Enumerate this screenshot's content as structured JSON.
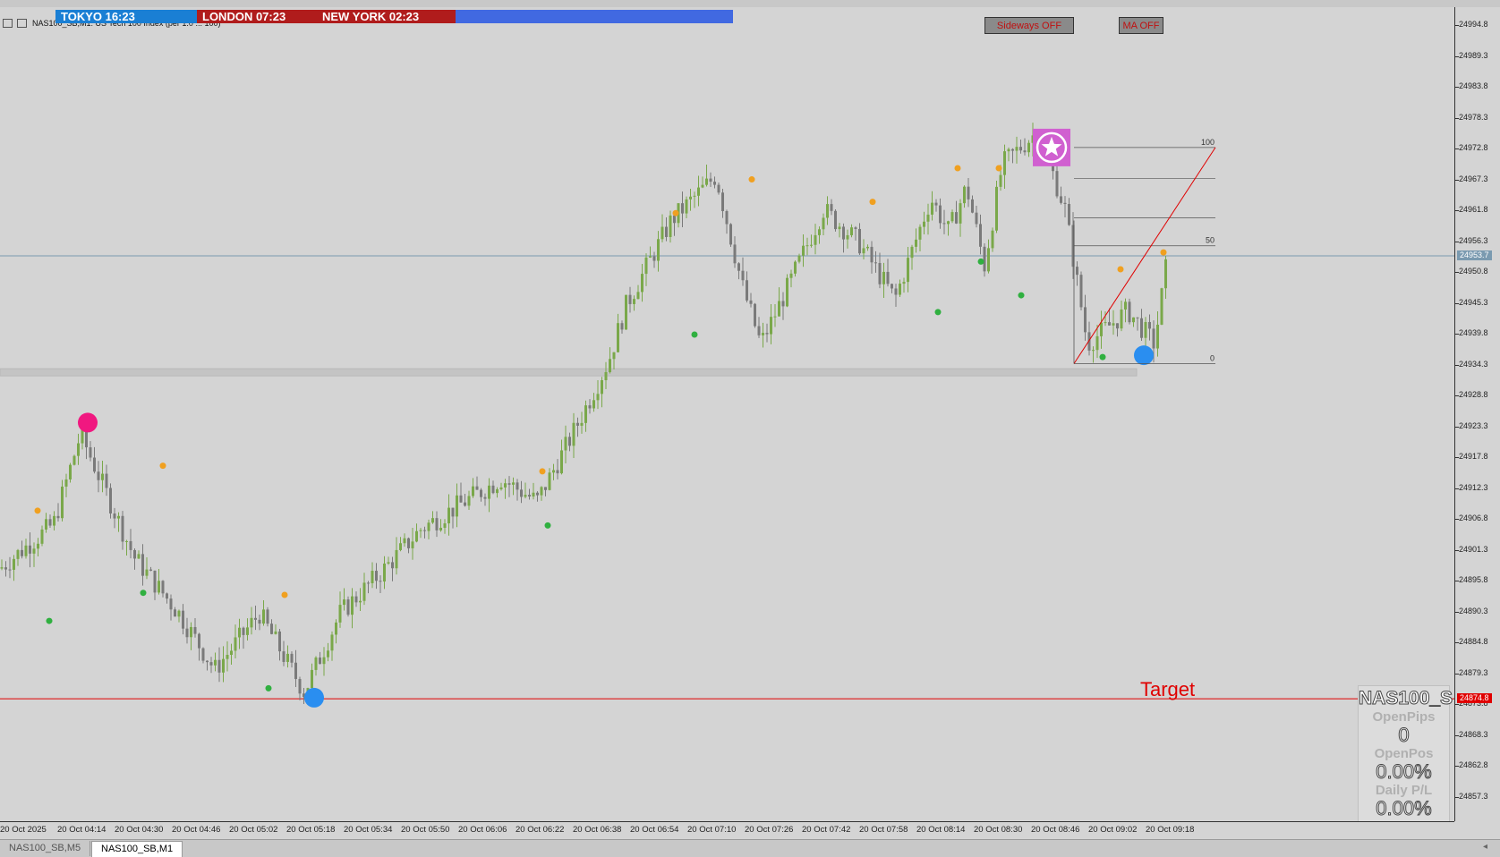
{
  "window": {
    "title": "NAS100_SB,M1",
    "chart_title": "NAS100_SB,M1: US Tech 100 Index (per 1.0 ... 100)"
  },
  "sessions": [
    {
      "label": "TOKYO  16:23",
      "color": "#1a7fd4"
    },
    {
      "label": "LONDON  07:23",
      "color": "#b01c1c"
    },
    {
      "label": "NEW YORK  02:23",
      "color": "#b01c1c"
    }
  ],
  "session_bar_color": "#4169e1",
  "buttons": {
    "sideways": "Sideways OFF",
    "ma": "MA OFF"
  },
  "stats_panel": {
    "symbol": "NAS100_S",
    "open_pips_label": "OpenPips",
    "open_pips_value": "0",
    "open_pos_label": "OpenPos",
    "open_pos_value": "0.00%",
    "daily_pl_label": "Daily P/L",
    "daily_pl_value": "0.00%"
  },
  "target_label": "Target",
  "tabs": [
    {
      "label": "NAS100_SB,M5",
      "active": false
    },
    {
      "label": "NAS100_SB,M1",
      "active": true
    }
  ],
  "price_axis": {
    "ticks": [
      "24994.8",
      "24989.3",
      "24983.8",
      "24978.3",
      "24972.8",
      "24967.3",
      "24961.8",
      "24956.3",
      "24950.8",
      "24945.3",
      "24939.8",
      "24934.3",
      "24928.8",
      "24923.3",
      "24917.8",
      "24912.3",
      "24906.8",
      "24901.3",
      "24895.8",
      "24890.3",
      "24884.8",
      "24879.3",
      "24873.8",
      "24868.3",
      "24862.8",
      "24857.3"
    ],
    "current_price": "24953.7",
    "target_price": "24874.8"
  },
  "time_axis": {
    "labels": [
      "20 Oct 2025",
      "20 Oct 04:14",
      "20 Oct 04:30",
      "20 Oct 04:46",
      "20 Oct 05:02",
      "20 Oct 05:18",
      "20 Oct 05:34",
      "20 Oct 05:50",
      "20 Oct 06:06",
      "20 Oct 06:22",
      "20 Oct 06:38",
      "20 Oct 06:54",
      "20 Oct 07:10",
      "20 Oct 07:26",
      "20 Oct 07:42",
      "20 Oct 07:58",
      "20 Oct 08:14",
      "20 Oct 08:30",
      "20 Oct 08:46",
      "20 Oct 09:02",
      "20 Oct 09:18"
    ]
  },
  "fib_levels": [
    "100",
    "50",
    "0"
  ],
  "colors": {
    "background": "#d4d4d4",
    "bull_candle": "#7aa84a",
    "bear_candle": "#7a7a7a",
    "swing_high_dot": "#f0a020",
    "swing_low_dot": "#30b040",
    "target_line": "#e00000",
    "current_price_line": "#7a9ab0",
    "big_dot_blue": "#2a8ef0",
    "big_dot_pink": "#f01880",
    "star_bg": "#d060d0"
  },
  "chart_data": {
    "type": "candlestick",
    "symbol": "NAS100_SB",
    "timeframe": "M1",
    "path": [
      [
        0,
        24898
      ],
      [
        30,
        24902
      ],
      [
        60,
        24906
      ],
      [
        90,
        24922
      ],
      [
        150,
        24900
      ],
      [
        200,
        24890
      ],
      [
        240,
        24880
      ],
      [
        290,
        24890
      ],
      [
        340,
        24876
      ],
      [
        380,
        24890
      ],
      [
        430,
        24898
      ],
      [
        470,
        24905
      ],
      [
        520,
        24910
      ],
      [
        560,
        24914
      ],
      [
        600,
        24910
      ],
      [
        640,
        24922
      ],
      [
        680,
        24935
      ],
      [
        700,
        24945
      ],
      [
        750,
        24960
      ],
      [
        800,
        24968
      ],
      [
        830,
        24948
      ],
      [
        850,
        24938
      ],
      [
        880,
        24948
      ],
      [
        920,
        24962
      ],
      [
        960,
        24956
      ],
      [
        1000,
        24946
      ],
      [
        1040,
        24964
      ],
      [
        1060,
        24958
      ],
      [
        1080,
        24966
      ],
      [
        1100,
        24952
      ],
      [
        1120,
        24970
      ],
      [
        1160,
        24976
      ],
      [
        1190,
        24962
      ],
      [
        1215,
        24938
      ],
      [
        1260,
        24944
      ],
      [
        1290,
        24938
      ],
      [
        1305,
        24954
      ]
    ],
    "swing_highs": [
      {
        "time_index": 42,
        "price": 24908
      },
      {
        "time_index": 182,
        "price": 24916
      },
      {
        "time_index": 318,
        "price": 24893
      },
      {
        "time_index": 606,
        "price": 24915
      },
      {
        "time_index": 755,
        "price": 24961
      },
      {
        "time_index": 840,
        "price": 24967
      },
      {
        "time_index": 975,
        "price": 24963
      },
      {
        "time_index": 1070,
        "price": 24969
      },
      {
        "time_index": 1116,
        "price": 24969
      },
      {
        "time_index": 1252,
        "price": 24951
      },
      {
        "time_index": 1300,
        "price": 24954
      }
    ],
    "swing_lows": [
      {
        "time_index": 55,
        "price": 24889
      },
      {
        "time_index": 160,
        "price": 24894
      },
      {
        "time_index": 300,
        "price": 24877
      },
      {
        "time_index": 612,
        "price": 24906
      },
      {
        "time_index": 776,
        "price": 24940
      },
      {
        "time_index": 1048,
        "price": 24944
      },
      {
        "time_index": 1096,
        "price": 24953
      },
      {
        "time_index": 1141,
        "price": 24947
      },
      {
        "time_index": 1232,
        "price": 24936
      }
    ],
    "big_markers": [
      {
        "kind": "top",
        "time_index": 98,
        "price": 24924,
        "color": "pink"
      },
      {
        "kind": "bottom",
        "time_index": 351,
        "price": 24875,
        "color": "blue"
      },
      {
        "kind": "bottom",
        "time_index": 1278,
        "price": 24936,
        "color": "blue"
      }
    ],
    "current_price": 24953.7,
    "target_price": 24874.8,
    "zone": {
      "from": 24933.6,
      "to": 24932.8
    },
    "ylim": [
      24853,
      24998
    ]
  }
}
